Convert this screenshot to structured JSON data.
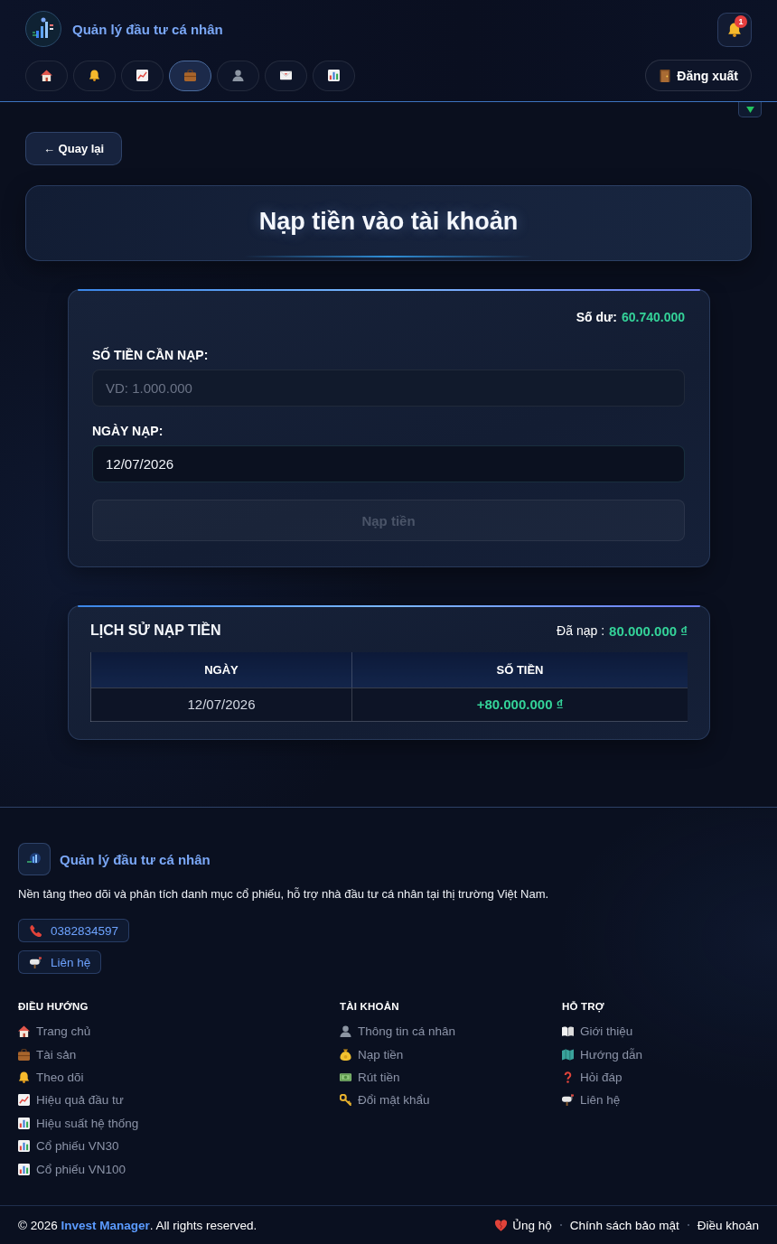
{
  "header": {
    "title": "Quản lý đầu tư cá nhân",
    "notifications": {
      "count": "1"
    },
    "nav": [
      {
        "selected": false
      },
      {
        "selected": false
      },
      {
        "selected": false
      },
      {
        "selected": true
      },
      {
        "selected": false
      },
      {
        "selected": false
      },
      {
        "selected": false
      }
    ],
    "logout": "Đăng xuất",
    "panel_toggle": {
      "expanded": false
    }
  },
  "back_button": "← Quay lại",
  "page_title": "Nạp tiền vào tài khoản",
  "deposit_form": {
    "balance_label": "Số dư:",
    "balance_value": "60.740.000",
    "fields": [
      {
        "label": "SỐ TIỀN CẦN NẠP:",
        "placeholder": "VD: 1.000.000"
      },
      {
        "label": "NGÀY NẠP:",
        "value": "12/07/2026"
      }
    ],
    "submit": {
      "label": "Nạp tiền",
      "disabled": true
    }
  },
  "history": {
    "title": "LỊCH SỬ NẠP TIỀN",
    "total_label": "Đã nạp :",
    "total_value": "80.000.000 ₫",
    "columns": [
      "NGÀY",
      "SỐ TIỀN"
    ],
    "rows": [
      {
        "date": "12/07/2026",
        "amount": "+80.000.000 ₫"
      }
    ]
  },
  "footer": {
    "brand": "Quản lý đầu tư cá nhân",
    "description": "Nền tảng theo dõi và phân tích danh mục cổ phiếu, hỗ trợ nhà đầu tư cá nhân tại thị trường Việt Nam.",
    "contacts": [
      "0382834597",
      "Liên hệ"
    ],
    "columns": [
      {
        "heading": "ĐIỀU HƯỚNG",
        "links": [
          "Trang chủ",
          "Tài sản",
          "Theo dõi",
          "Hiệu quả đầu tư",
          "Hiệu suất hệ thống",
          "Cổ phiếu VN30",
          "Cổ phiếu VN100"
        ]
      },
      {
        "heading": "TÀI KHOẢN",
        "links": [
          "Thông tin cá nhân",
          "Nạp tiền",
          "Rút tiền",
          "Đổi mật khẩu"
        ]
      },
      {
        "heading": "HỖ TRỢ",
        "links": [
          "Giới thiệu",
          "Hướng dẫn",
          "Hỏi đáp",
          "Liên hệ"
        ]
      }
    ],
    "copyright": {
      "prefix": "© 2026",
      "link": "Invest Manager",
      "suffix": ". All rights reserved."
    },
    "bottom_links": [
      "Ủng hộ",
      "Chính sách bảo mật",
      "Điều khoản"
    ]
  }
}
